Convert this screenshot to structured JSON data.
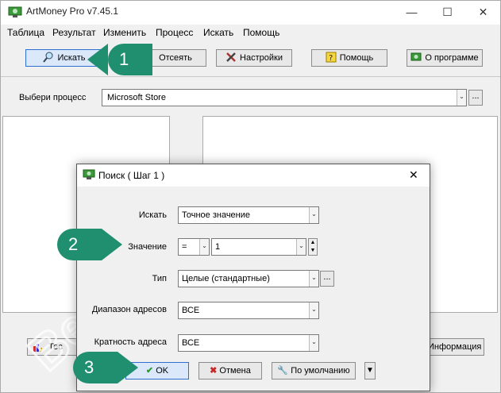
{
  "app": {
    "title": "ArtMoney Pro v7.45.1"
  },
  "window_controls": {
    "minimize": "—",
    "maximize": "☐",
    "close": "✕"
  },
  "menu": [
    "Таблица",
    "Результат",
    "Изменить",
    "Процесс",
    "Искать",
    "Помощь"
  ],
  "toolbar": {
    "search": "Искать",
    "filter": "Отсеять",
    "settings": "Настройки",
    "help": "Помощь",
    "about": "О программе"
  },
  "process": {
    "label": "Выбери процесс",
    "value": "Microsoft Store",
    "browse": "..."
  },
  "bottom": {
    "test": "Тес",
    "info": "Информация"
  },
  "dialog": {
    "title": "Поиск ( Шаг 1 )",
    "close": "✕",
    "search_label": "Искать",
    "search_value": "Точное значение",
    "value_label": "Значение",
    "operator": "=",
    "value": "1",
    "type_label": "Тип",
    "type_value": "Целые (стандартные)",
    "type_browse": "...",
    "range_label": "Диапазон адресов",
    "range_value": "ВСЕ",
    "align_label": "Кратность адреса",
    "align_value": "ВСЕ",
    "ok": "OK",
    "cancel": "Отмена",
    "default": "По умолчанию",
    "more": "▼"
  },
  "annotations": [
    "1",
    "2",
    "3"
  ],
  "watermark": "BestSoft.club",
  "colors": {
    "badge": "#1f8f70",
    "ok_icon": "#2e9b2e",
    "cancel_icon": "#c62828"
  }
}
